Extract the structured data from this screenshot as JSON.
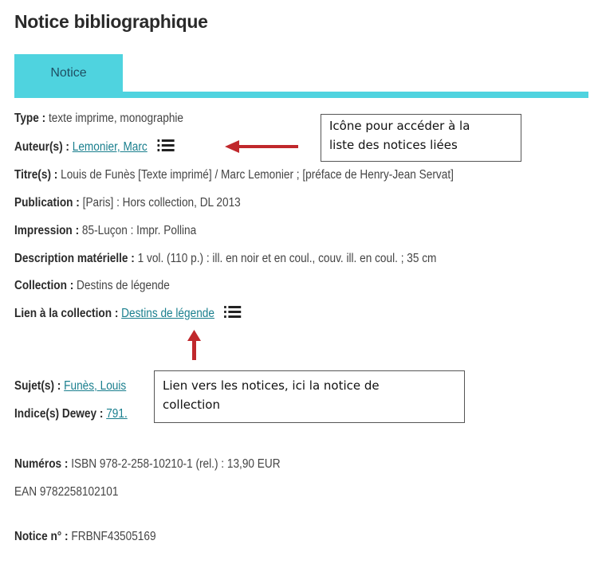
{
  "page_title": "Notice bibliographique",
  "tab_label": "Notice",
  "fields": {
    "type": {
      "label": "Type",
      "value": "texte imprime, monographie"
    },
    "auteur": {
      "label": "Auteur(s)",
      "link": "Lemonier, Marc"
    },
    "titre": {
      "label": "Titre(s)",
      "value": "Louis de Funès [Texte imprimé] / Marc Lemonier ; [préface de Henry-Jean Servat]"
    },
    "publication": {
      "label": "Publication",
      "value": "[Paris] : Hors collection, DL 2013"
    },
    "impression": {
      "label": "Impression",
      "value": "85-Luçon : Impr. Pollina"
    },
    "description": {
      "label": "Description matérielle",
      "value": "1 vol. (110 p.) : ill. en noir et en coul., couv. ill. en coul. ; 35 cm"
    },
    "collection": {
      "label": "Collection",
      "value": "Destins de légende"
    },
    "lien_collection": {
      "label": "Lien à la collection",
      "link": "Destins de légende"
    },
    "sujet": {
      "label": "Sujet(s)",
      "link": "Funès, Louis"
    },
    "dewey": {
      "label": "Indice(s) Dewey",
      "link": "791."
    },
    "numeros": {
      "label": "Numéros",
      "value": "ISBN 978-2-258-10210-1 (rel.) : 13,90 EUR",
      "ean": "EAN 9782258102101"
    },
    "notice_no": {
      "label": "Notice n°",
      "value": "FRBNF43505169"
    }
  },
  "callouts": {
    "icon_note": {
      "line1": "Icône pour accéder à la",
      "line2": "liste des notices liées"
    },
    "link_note": {
      "line1": "Lien vers les notices, ici la notice de",
      "line2": "collection"
    }
  },
  "colors": {
    "tab": "#4fd3df",
    "link": "#1a7f8e",
    "arrow": "#c0282c"
  },
  "icons": [
    "list-icon",
    "arrow-left",
    "arrow-up"
  ]
}
